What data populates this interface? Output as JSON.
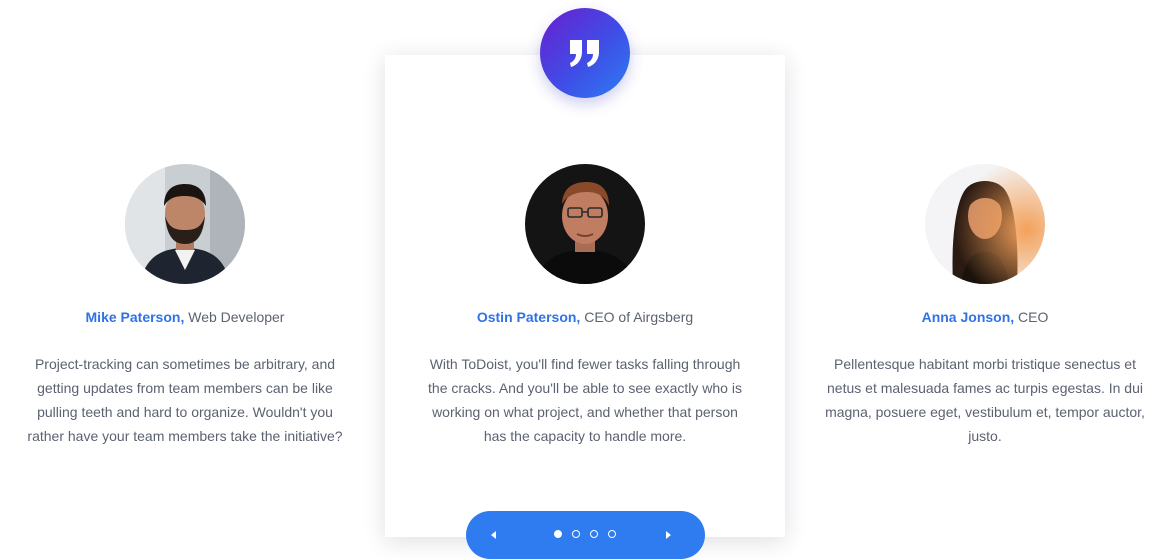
{
  "testimonials": [
    {
      "name": "Mike Paterson,",
      "role": "Web Developer",
      "quote": "Project-tracking can sometimes be arbitrary, and getting updates from team members can be like pulling teeth and hard to organize. Wouldn't you rather have your team members take the initiative?",
      "avatar": "avatar-man-beard"
    },
    {
      "name": "Ostin Paterson,",
      "role": "CEO of Airgsberg",
      "quote": "With ToDoist, you'll find fewer tasks falling through the cracks. And you'll be able to see exactly who is working on what project, and whether that person has the capacity to handle more.",
      "avatar": "avatar-man-glasses"
    },
    {
      "name": "Anna Jonson,",
      "role": "CEO",
      "quote": "Pellentesque habitant morbi tristique senectus et netus et malesuada fames ac turpis egestas. In dui magna, posuere eget, vestibulum et, tempor auctor, justo.",
      "avatar": "avatar-woman"
    }
  ],
  "active_slide": 1,
  "slide_count": 4,
  "icons": {
    "quote": "quote-icon",
    "prev": "arrow-left-icon",
    "next": "arrow-right-icon"
  },
  "colors": {
    "accent_blue": "#2f7bf0",
    "gradient_purple": "#6a1fd0",
    "name_blue": "#2f73e6",
    "body_text": "#5b6270"
  }
}
